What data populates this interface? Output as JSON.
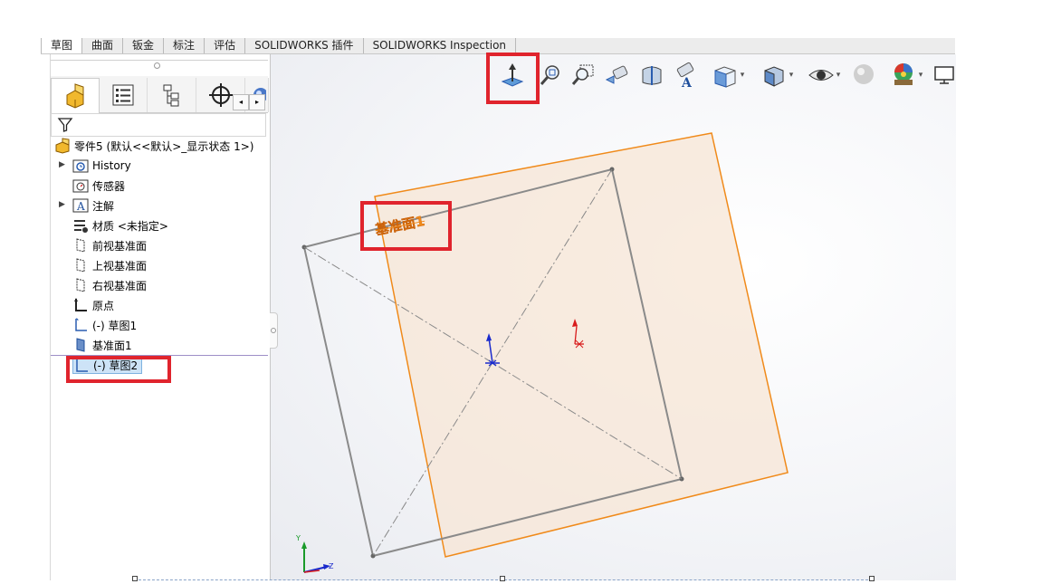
{
  "tabs": [
    "草图",
    "曲面",
    "钣金",
    "标注",
    "评估",
    "SOLIDWORKS 插件",
    "SOLIDWORKS Inspection"
  ],
  "tree": {
    "root": "零件5 (默认<<默认>_显示状态 1>)",
    "items": [
      {
        "label": "History",
        "icon": "history-folder-icon",
        "expandable": true
      },
      {
        "label": "传感器",
        "icon": "sensor-icon",
        "expandable": false
      },
      {
        "label": "注解",
        "icon": "annotation-icon",
        "expandable": true
      },
      {
        "label": "材质 <未指定>",
        "icon": "material-icon",
        "expandable": false
      },
      {
        "label": "前视基准面",
        "icon": "plane-icon",
        "expandable": false
      },
      {
        "label": "上视基准面",
        "icon": "plane-icon",
        "expandable": false
      },
      {
        "label": "右视基准面",
        "icon": "plane-icon",
        "expandable": false
      },
      {
        "label": "原点",
        "icon": "origin-icon",
        "expandable": false
      },
      {
        "label": "(-) 草图1",
        "icon": "sketch-icon",
        "expandable": false
      },
      {
        "label": "基准面1",
        "icon": "plane-feature-icon",
        "expandable": false
      },
      {
        "label": "(-) 草图2",
        "icon": "sketch-icon",
        "expandable": false,
        "selected": true
      }
    ]
  },
  "viewport": {
    "plane_label": "基准面1",
    "triad": {
      "y": "Y",
      "z": "Z"
    }
  },
  "colors": {
    "highlight_red": "#e0242d",
    "plane_orange": "#f08a1a",
    "sketch_gray": "#8a8a8a",
    "selection_blue": "#cde3f7"
  }
}
